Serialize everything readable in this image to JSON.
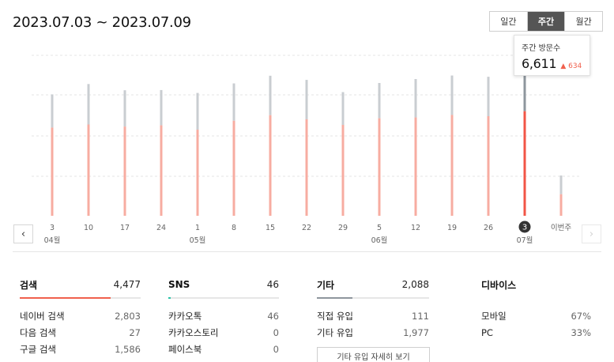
{
  "header": {
    "range": "2023.07.03 ~ 2023.07.09",
    "periods": [
      {
        "label": "일간",
        "active": false
      },
      {
        "label": "주간",
        "active": true
      },
      {
        "label": "월간",
        "active": false
      }
    ]
  },
  "tooltip": {
    "label": "주간 방문수",
    "value": "6,611",
    "delta": "634",
    "delta_arrow": "▲"
  },
  "colors": {
    "bar_past": "#f7aca1",
    "bar_current": "#f25546",
    "cap_past": "#c9cdd1",
    "cap_current": "#8e969d",
    "search": "#f0604d",
    "sns": "#2bc4a8",
    "etc": "#8e969d"
  },
  "nav": {
    "prev_icon": "‹",
    "next_icon": "›"
  },
  "chart_data": {
    "type": "bar",
    "categories": [
      "3",
      "10",
      "17",
      "24",
      "1",
      "8",
      "15",
      "22",
      "29",
      "5",
      "12",
      "19",
      "26",
      "3",
      "이번주"
    ],
    "month_labels": [
      {
        "label": "04월",
        "at": 0
      },
      {
        "label": "05월",
        "at": 4
      },
      {
        "label": "06월",
        "at": 9
      },
      {
        "label": "07월",
        "at": 13
      }
    ],
    "selected_index": 13,
    "ymax": 8000,
    "series": [
      {
        "values": [
          4250,
          4400,
          4300,
          4360,
          4150,
          4580,
          4850,
          4650,
          4380,
          4700,
          4740,
          4860,
          4800,
          5040,
          1040
        ]
      },
      {
        "values": [
          1600,
          1950,
          1750,
          1700,
          1770,
          1800,
          1900,
          1900,
          1580,
          1700,
          1850,
          1900,
          1900,
          2340,
          900
        ]
      }
    ]
  },
  "panels": [
    {
      "title": "검색",
      "total": "4,477",
      "fill": 0.75,
      "color_key": "search",
      "rows": [
        {
          "label": "네이버 검색",
          "value": "2,803"
        },
        {
          "label": "다음 검색",
          "value": "27"
        },
        {
          "label": "구글 검색",
          "value": "1,586"
        }
      ]
    },
    {
      "title": "SNS",
      "total": "46",
      "fill": 0.02,
      "color_key": "sns",
      "rows": [
        {
          "label": "카카오톡",
          "value": "46"
        },
        {
          "label": "카카오스토리",
          "value": "0"
        },
        {
          "label": "페이스북",
          "value": "0"
        }
      ]
    },
    {
      "title": "기타",
      "total": "2,088",
      "fill": 0.32,
      "color_key": "etc",
      "rows": [
        {
          "label": "직접 유입",
          "value": "111"
        },
        {
          "label": "기타 유입",
          "value": "1,977"
        }
      ],
      "button": "기타 유입 자세히 보기"
    },
    {
      "title": "디바이스",
      "total": "",
      "rows": [
        {
          "label": "모바일",
          "value": "67%"
        },
        {
          "label": "PC",
          "value": "33%"
        }
      ]
    }
  ]
}
